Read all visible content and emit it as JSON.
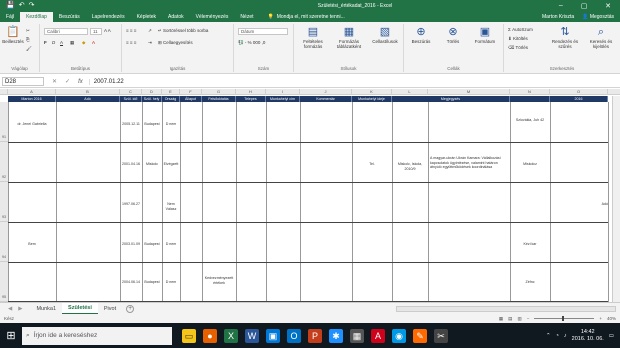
{
  "window": {
    "title": "Születési_értékadat_2016 - Excel",
    "qat_icons": [
      "save-icon",
      "undo-icon",
      "redo-icon"
    ],
    "controls": [
      "–",
      "▢",
      "✕"
    ]
  },
  "menu": {
    "tabs": [
      "Fájl",
      "Kezdőlap",
      "Beszúrás",
      "Lapelrendezés",
      "Képletek",
      "Adatok",
      "Véleményezés",
      "Nézet"
    ],
    "active_tab": "Kezdőlap",
    "tell_me": "Mondja el, mit szeretne tenni...",
    "user": "Marton Kriszta",
    "share": "Megosztás"
  },
  "ribbon": {
    "clipboard": {
      "paste": "Beillesztés",
      "group": "Vágólap"
    },
    "font": {
      "name": "Calibri",
      "size": "11",
      "group": "Betűtípus"
    },
    "alignment": {
      "wrap": "Sortöréssel több sorba",
      "merge": "Cellaegyesítés",
      "group": "Igazítás"
    },
    "number": {
      "format": "Dátum",
      "group": "Szám"
    },
    "styles": {
      "conditional": "Feltételes formázás",
      "table": "Formázás táblázatként",
      "cell": "Cellastílusok",
      "group": "Stílusok"
    },
    "cells": {
      "insert": "Beszúrás",
      "delete": "Törlés",
      "format": "Formátum",
      "group": "Cellák"
    },
    "editing": {
      "autosum": "AutoSzum",
      "fill": "Kitöltés",
      "clear": "Törlés",
      "sort": "Rendezés és szűrés",
      "find": "Keresés és kijelölés",
      "group": "Szerkesztés"
    }
  },
  "formula_bar": {
    "name_box": "D28",
    "fx": "fx",
    "value": "2007.01.22"
  },
  "columns": [
    "A",
    "B",
    "C",
    "D",
    "E",
    "F",
    "G",
    "H",
    "I",
    "J",
    "K",
    "L",
    "M",
    "N",
    "O"
  ],
  "header_row": [
    "Marton 2016",
    "Adó",
    "Szül. idő",
    "Szül. hely",
    "Ország",
    "Állapot",
    "Felsőoktatás",
    "Telepes",
    "Munkahelyi cím",
    "Kommentár",
    "Munkahelyi ideje",
    "Megjegyzés",
    "",
    "2016"
  ],
  "rows": [
    {
      "num": "91",
      "cells": {
        "A": "dr. Jenei Gabriella",
        "D": "2005.12.11",
        "E": "Budapest",
        "F": "D nem",
        "N": "Szlovákia, Juh 42"
      }
    },
    {
      "num": "92",
      "cells": {
        "D": "2001.04.16",
        "E": "Miskolc",
        "F": "Elvégzett",
        "J": "Tel.",
        "K": "Miskolc, Iskola, 2010/9",
        "L": "A magyar-ukrán Ukrán Kamara: Vállalkozási kapcsolatok ügyintézése, valamint határon átnyúló együttműködések koordinálása",
        "N": "Miskolcz"
      }
    },
    {
      "num": "93",
      "cells": {
        "D": "1997.06.27",
        "F": "Nem Válasz",
        "O": "Adó"
      }
    },
    {
      "num": "94",
      "cells": {
        "A": "Bem",
        "D": "2003.01.09",
        "E": "Budapest",
        "F": "D nem",
        "N": "Kézi kar"
      }
    },
    {
      "num": "95",
      "cells": {
        "D": "2004.06.14",
        "E": "Budapest",
        "F": "D nem",
        "G": "Kedvezményezett értékek",
        "N": "Zéfnc"
      }
    }
  ],
  "sheets": [
    "Munka1",
    "Születési",
    "Pivot"
  ],
  "active_sheet": "Születési",
  "status": {
    "left": "Kész",
    "zoom": "40%"
  },
  "taskbar": {
    "search_placeholder": "Írjon ide a kereséshez",
    "time": "14:42",
    "date": "2016. 10. 06."
  }
}
